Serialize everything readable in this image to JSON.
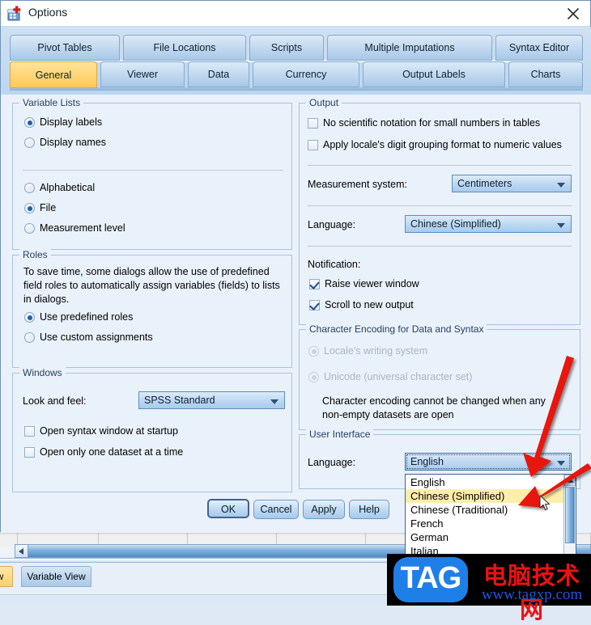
{
  "window": {
    "title": "Options",
    "icon": "spss-options-icon",
    "close_label": "close-icon"
  },
  "tabs": {
    "row1": [
      {
        "label": "Pivot Tables",
        "active": false
      },
      {
        "label": "File Locations",
        "active": false
      },
      {
        "label": "Scripts",
        "active": false
      },
      {
        "label": "Multiple Imputations",
        "active": false
      },
      {
        "label": "Syntax Editor",
        "active": false
      }
    ],
    "row2": [
      {
        "label": "General",
        "active": true
      },
      {
        "label": "Viewer",
        "active": false
      },
      {
        "label": "Data",
        "active": false
      },
      {
        "label": "Currency",
        "active": false
      },
      {
        "label": "Output Labels",
        "active": false
      },
      {
        "label": "Charts",
        "active": false
      }
    ]
  },
  "variable_lists": {
    "legend": "Variable Lists",
    "display_labels": "Display labels",
    "display_names": "Display names",
    "alphabetical": "Alphabetical",
    "file": "File",
    "measurement_level": "Measurement level",
    "selected_display": "Display labels",
    "selected_order": "File"
  },
  "roles": {
    "legend": "Roles",
    "description_line1": "To save time, some dialogs allow the use of predefined",
    "description_line2": "field roles to automatically assign variables (fields) to lists",
    "description_line3": "in dialogs.",
    "use_predefined": "Use predefined roles",
    "use_custom": "Use custom assignments",
    "selected": "Use predefined roles"
  },
  "windows": {
    "legend": "Windows",
    "look_and_feel_label": "Look and feel:",
    "look_and_feel_value": "SPSS Standard",
    "open_syntax": "Open syntax window at startup",
    "open_syntax_checked": false,
    "open_one_dataset": "Open only one dataset at a time",
    "open_one_dataset_checked": false
  },
  "output": {
    "legend": "Output",
    "no_scientific": "No scientific notation for small numbers in tables",
    "no_scientific_checked": false,
    "apply_locale": "Apply locale's digit  grouping format to numeric values",
    "apply_locale_checked": false,
    "measurement_label": "Measurement system:",
    "measurement_value": "Centimeters",
    "language_label": "Language:",
    "language_value": "Chinese (Simplified)",
    "notification_label": "Notification:",
    "raise_viewer": "Raise viewer window",
    "raise_viewer_checked": true,
    "scroll_new_output": "Scroll to new output",
    "scroll_new_output_checked": true
  },
  "character_encoding": {
    "legend": "Character Encoding for Data and Syntax",
    "locale_option": "Locale's writing system",
    "unicode_option": "Unicode (universal character set)",
    "selected": "Locale's writing system",
    "note_line1": "Character encoding cannot be changed when any",
    "note_line2": "non-empty datasets are open",
    "disabled": true
  },
  "user_interface": {
    "legend": "User Interface",
    "language_label": "Language:",
    "language_value": "English",
    "dropdown_open": true,
    "options": [
      "English",
      "Chinese (Simplified)",
      "Chinese (Traditional)",
      "French",
      "German",
      "Italian"
    ],
    "highlighted_option": "Chinese (Simplified)"
  },
  "buttons": {
    "ok": "OK",
    "cancel": "Cancel",
    "apply": "Apply",
    "help": "Help",
    "default": "OK"
  },
  "background": {
    "sheet_tab_data": "w",
    "sheet_tab_variable": "Variable View"
  },
  "watermark": {
    "badge": "TAG",
    "chinese": "电脑技术网",
    "url": "www.tagxp.com"
  },
  "colors": {
    "accent_tab_active": "#ffd779",
    "dialog_bg": "#eaf1fa",
    "group_border": "#a9c3dc",
    "combo_border": "#5f8cb8",
    "annotation_arrow": "#e8120c",
    "highlight_row": "#ffeeaa"
  }
}
